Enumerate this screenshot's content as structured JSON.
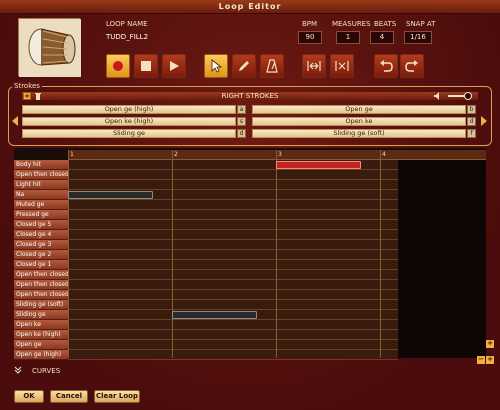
{
  "window": {
    "title": "Loop Editor"
  },
  "loop": {
    "name_label": "LOOP NAME",
    "name_value": "TUDD_FILL2"
  },
  "settings": [
    {
      "label": "BPM",
      "value": "90"
    },
    {
      "label": "MEASURES",
      "value": "1"
    },
    {
      "label": "BEATS",
      "value": "4"
    },
    {
      "label": "SNAP AT",
      "value": "1/16"
    }
  ],
  "strokes": {
    "section_label": "Strokes",
    "bar_title": "RIGHT STROKES",
    "left": [
      {
        "label": "Open ge (high)",
        "key": "a"
      },
      {
        "label": "Open ke (high)",
        "key": "s"
      },
      {
        "label": "Sliding ge",
        "key": "d"
      }
    ],
    "right": [
      {
        "label": "Open ge",
        "key": "b"
      },
      {
        "label": "Open ke",
        "key": "d"
      },
      {
        "label": "Sliding ge (soft)",
        "key": "f"
      }
    ]
  },
  "ruler": {
    "beats": [
      "1",
      "2",
      "3",
      "4"
    ]
  },
  "rows": [
    "Body hit",
    "Open then closed ge",
    "Light hit",
    "Na",
    "Muted ge",
    "Pressed ge",
    "Closed ge 5",
    "Closed ge 4",
    "Closed ge 3",
    "Closed ge 2",
    "Closed ge 1",
    "Open then closed ge",
    "Open then closed ge (h...",
    "Open then closed ge (h...",
    "Sliding ge (soft)",
    "Sliding ge",
    "Open ke",
    "Open ke (high)",
    "Open ge",
    "Open ge (high)"
  ],
  "notes": [
    {
      "row": 0,
      "start_beat": 3.0,
      "length_beats": 0.85,
      "color": "#c02424"
    },
    {
      "row": 3,
      "start_beat": 1.0,
      "length_beats": 0.85,
      "color": "#2a2a2a"
    },
    {
      "row": 15,
      "start_beat": 2.0,
      "length_beats": 0.85,
      "color": "#2a2a2a"
    }
  ],
  "curves": {
    "label": "CURVES"
  },
  "buttons": {
    "ok": "OK",
    "cancel": "Cancel",
    "clear": "Clear Loop"
  },
  "colors": {
    "accent": "#f0a020",
    "bg": "#5a1010",
    "note_selected": "#c02424"
  }
}
